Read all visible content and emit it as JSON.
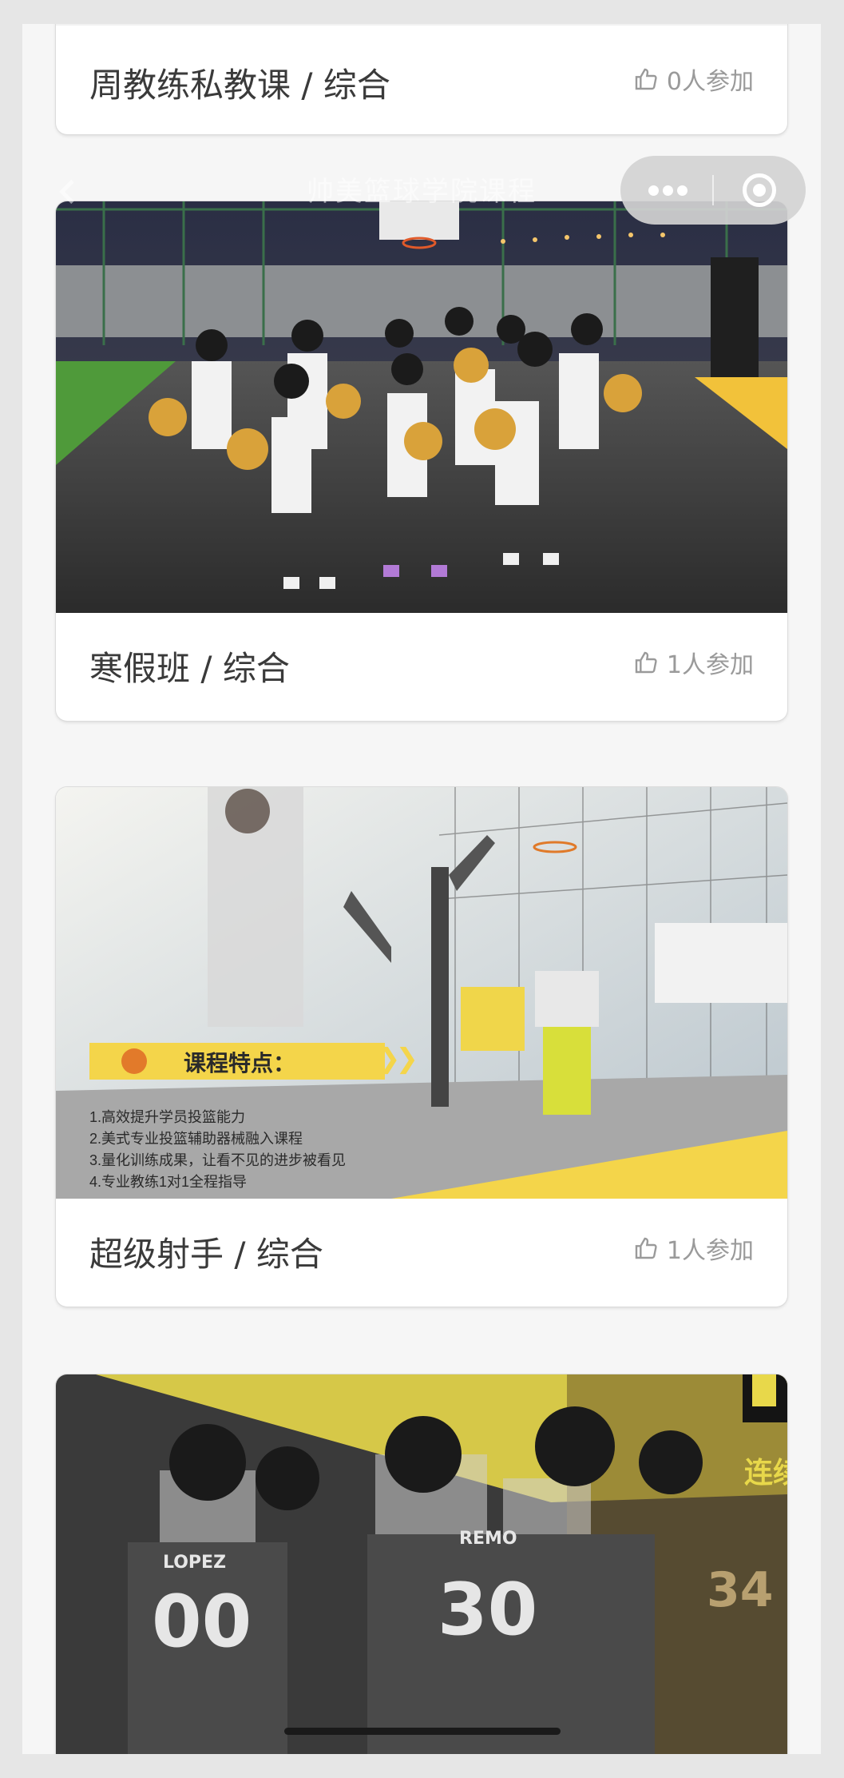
{
  "nav": {
    "title": "帅美篮球学院课程",
    "back_icon": "chevron-left-icon",
    "menu_icon": "more-dots-icon",
    "close_icon": "target-circle-icon"
  },
  "courses": [
    {
      "name": "周教练私教课 / 综合",
      "join": "0人参加",
      "image": "coach-private-lesson"
    },
    {
      "name": "寒假班 / 综合",
      "join": "1人参加",
      "image": "kids-team-photo-on-court"
    },
    {
      "name": "超级射手 / 综合",
      "join": "1人参加",
      "image": "shooting-machine-court",
      "banner": "课程特点：",
      "features": [
        "1.高效提升学员投篮能力",
        "2.美式专业投篮辅助器械融入课程",
        "3.量化训练成果，让看不见的进步被看见",
        "4.专业教练1对1全程指导"
      ]
    },
    {
      "name": "",
      "join": "",
      "image": "players-huddle",
      "overlay_text": "连续",
      "jerseys": [
        "LOPEZ",
        "00",
        "REMO",
        "30",
        "34"
      ]
    }
  ],
  "colors": {
    "accent": "#f4d54a",
    "page_bg": "#f6f6f6",
    "text": "#3a3a3a",
    "muted": "#9a9a9a"
  }
}
